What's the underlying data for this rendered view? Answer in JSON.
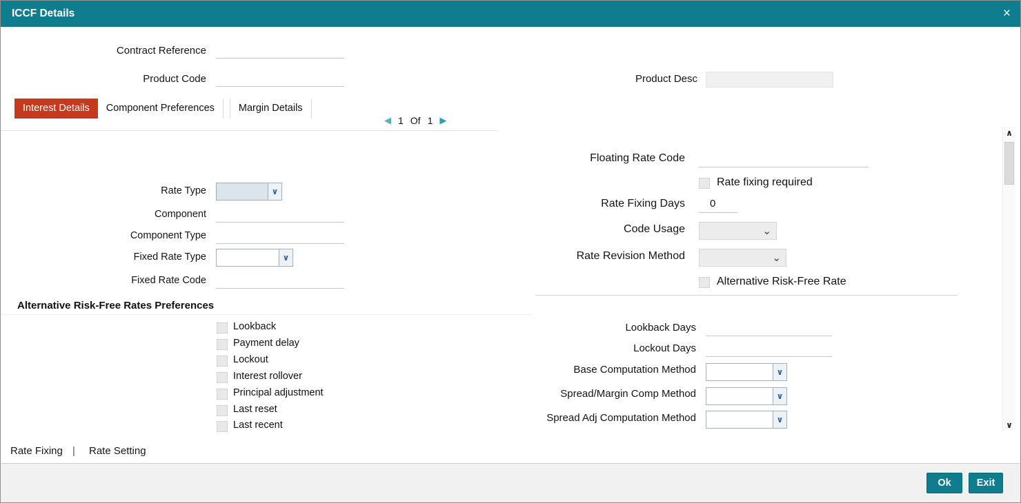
{
  "window": {
    "title": "ICCF Details",
    "close_icon": "×"
  },
  "header": {
    "contract_reference": {
      "label": "Contract Reference",
      "value": ""
    },
    "product_code": {
      "label": "Product Code",
      "value": ""
    },
    "product_desc": {
      "label": "Product Desc",
      "value": ""
    }
  },
  "tabs": [
    {
      "label": "Interest Details",
      "active": true
    },
    {
      "label": "Component Preferences",
      "active": false
    },
    {
      "label": "Margin Details",
      "active": false
    }
  ],
  "pagination": {
    "prev_icon": "◀",
    "page": "1",
    "of": "Of",
    "total": "1",
    "next_icon": "▶"
  },
  "scrollbar": {
    "up_icon": "∧",
    "down_icon": "∨"
  },
  "interest_details": {
    "rate_type": {
      "label": "Rate Type",
      "value": ""
    },
    "component": {
      "label": "Component",
      "value": ""
    },
    "component_type": {
      "label": "Component Type",
      "value": ""
    },
    "fixed_rate_type": {
      "label": "Fixed Rate Type",
      "value": ""
    },
    "fixed_rate_code": {
      "label": "Fixed Rate Code",
      "value": ""
    },
    "floating_rate_code": {
      "label": "Floating Rate Code",
      "value": ""
    },
    "rate_fixing_required": {
      "label": "Rate fixing required",
      "checked": false
    },
    "rate_fixing_days": {
      "label": "Rate Fixing Days",
      "value": "0"
    },
    "code_usage": {
      "label": "Code Usage",
      "value": ""
    },
    "rate_revision_method": {
      "label": "Rate Revision Method",
      "value": ""
    },
    "alternative_risk_free_rate": {
      "label": "Alternative Risk-Free Rate",
      "checked": false
    }
  },
  "arfr_preferences": {
    "section_title": "Alternative Risk-Free Rates Preferences",
    "checkboxes": [
      {
        "label": "Lookback",
        "checked": false
      },
      {
        "label": "Payment delay",
        "checked": false
      },
      {
        "label": "Lockout",
        "checked": false
      },
      {
        "label": "Interest rollover",
        "checked": false
      },
      {
        "label": "Principal adjustment",
        "checked": false
      },
      {
        "label": "Last reset",
        "checked": false
      },
      {
        "label": "Last recent",
        "checked": false
      }
    ],
    "lookback_days": {
      "label": "Lookback Days",
      "value": ""
    },
    "lockout_days": {
      "label": "Lockout Days",
      "value": ""
    },
    "base_computation_method": {
      "label": "Base Computation Method",
      "value": ""
    },
    "spread_margin_comp_method": {
      "label": "Spread/Margin Comp Method",
      "value": ""
    },
    "spread_adj_computation_method": {
      "label": "Spread Adj Computation Method",
      "value": ""
    }
  },
  "action_links": [
    {
      "label": "Rate Fixing"
    },
    {
      "label": "Rate Setting"
    }
  ],
  "link_separator": "|",
  "footer": {
    "ok_label": "Ok",
    "exit_label": "Exit"
  },
  "colors": {
    "titlebar": "#0f7d8e",
    "active_tab": "#c5391f",
    "button": "#0f7d8e",
    "pagination_arrow": "#2a9fb5"
  }
}
